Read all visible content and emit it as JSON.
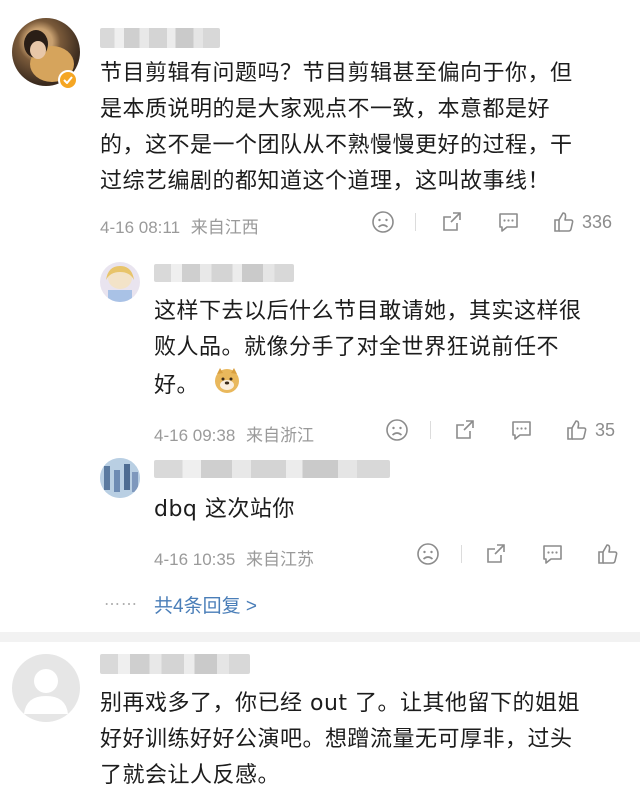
{
  "comment1": {
    "text_lines": [
      "节目剪辑有问题吗？节目剪辑甚至偏向于你，但",
      "是本质说明的是大家观点不一致，本意都是好",
      "的，这不是一个团队从不熟慢慢更好的过程，干",
      "过综艺编剧的都知道这个道理，这叫故事线！"
    ],
    "timestamp": "4-16 08:11",
    "location": "来自江西",
    "likes": "336"
  },
  "reply1": {
    "text_lines": [
      "这样下去以后什么节目敢请她，其实这样很",
      "败人品。就像分手了对全世界狂说前任不",
      "好。"
    ],
    "timestamp": "4-16 09:38",
    "location": "来自浙江",
    "likes": "35"
  },
  "reply2": {
    "text": "dbq 这次站你",
    "timestamp": "4-16 10:35",
    "location": "来自江苏"
  },
  "more_replies": {
    "dots": "……",
    "label": "共4条回复 >"
  },
  "comment2": {
    "text_lines": [
      "别再戏多了，你已经 out 了。让其他留下的姐姐",
      "好好训练好好公演吧。想蹭流量无可厚非，过头",
      "了就会让人反感。"
    ]
  },
  "icons": [
    "verified-badge-icon",
    "dislike-face-icon",
    "share-icon",
    "comment-icon",
    "thumbs-up-icon",
    "doge-emoji-icon"
  ],
  "colors": {
    "link": "#4a7eb8",
    "meta": "#9a9a9a",
    "verified": "#f5a623"
  }
}
